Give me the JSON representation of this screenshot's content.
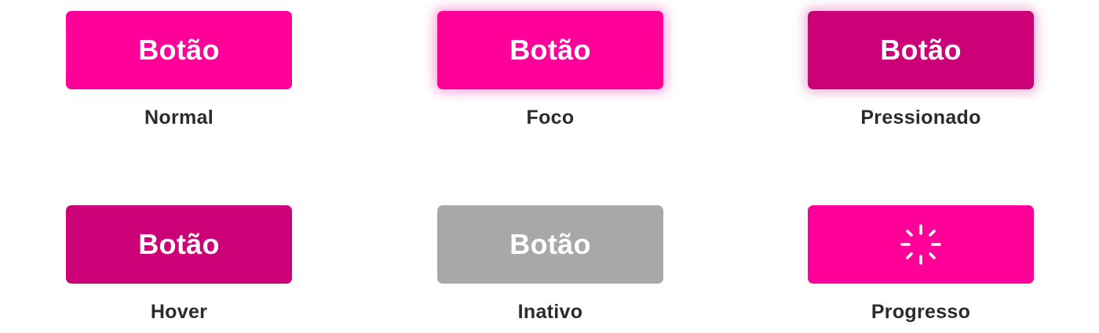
{
  "colors": {
    "primary": "#ff0099",
    "primary_dark": "#cc0077",
    "inactive": "#a8a8a8",
    "label_text": "#2b2b2b",
    "button_text": "#ffffff"
  },
  "states": [
    {
      "button_label": "Botão",
      "caption": "Normal"
    },
    {
      "button_label": "Botão",
      "caption": "Foco"
    },
    {
      "button_label": "Botão",
      "caption": "Pressionado"
    },
    {
      "button_label": "Botão",
      "caption": "Hover"
    },
    {
      "button_label": "Botão",
      "caption": "Inativo"
    },
    {
      "button_label": "",
      "caption": "Progresso",
      "icon": "spinner-icon"
    }
  ]
}
